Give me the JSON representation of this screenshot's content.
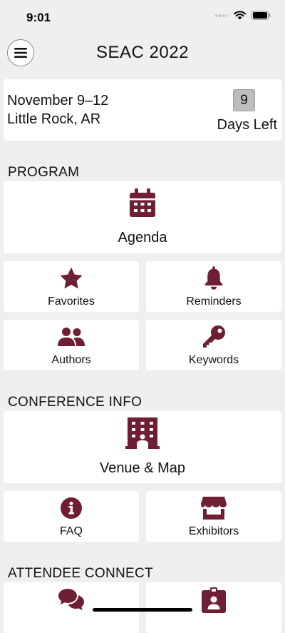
{
  "status": {
    "time": "9:01"
  },
  "header": {
    "title": "SEAC 2022"
  },
  "event": {
    "dates": "November 9–12",
    "location": "Little Rock, AR",
    "days_left": "9",
    "days_left_label": "Days Left"
  },
  "sections": {
    "program": "PROGRAM",
    "conference_info": "CONFERENCE INFO",
    "attendee_connect": "ATTENDEE CONNECT"
  },
  "tiles": {
    "agenda": "Agenda",
    "favorites": "Favorites",
    "reminders": "Reminders",
    "authors": "Authors",
    "keywords": "Keywords",
    "venue": "Venue & Map",
    "faq": "FAQ",
    "exhibitors": "Exhibitors"
  },
  "colors": {
    "accent": "#6e1f33",
    "background": "#efefef",
    "card": "#ffffff"
  }
}
